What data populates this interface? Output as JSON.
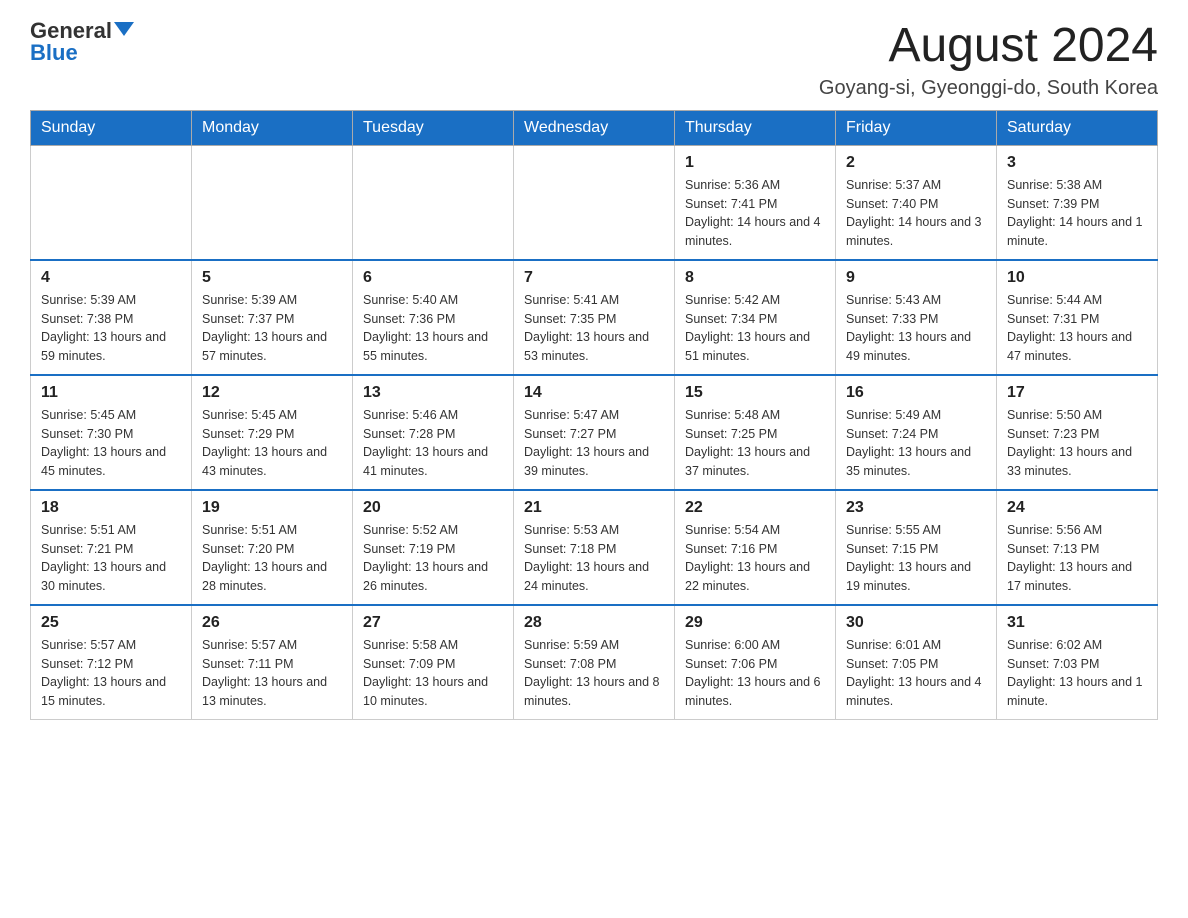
{
  "header": {
    "logo_general": "General",
    "logo_blue": "Blue",
    "month_title": "August 2024",
    "location": "Goyang-si, Gyeonggi-do, South Korea"
  },
  "days_of_week": [
    "Sunday",
    "Monday",
    "Tuesday",
    "Wednesday",
    "Thursday",
    "Friday",
    "Saturday"
  ],
  "weeks": [
    [
      {
        "day": "",
        "sunrise": "",
        "sunset": "",
        "daylight": ""
      },
      {
        "day": "",
        "sunrise": "",
        "sunset": "",
        "daylight": ""
      },
      {
        "day": "",
        "sunrise": "",
        "sunset": "",
        "daylight": ""
      },
      {
        "day": "",
        "sunrise": "",
        "sunset": "",
        "daylight": ""
      },
      {
        "day": "1",
        "sunrise": "Sunrise: 5:36 AM",
        "sunset": "Sunset: 7:41 PM",
        "daylight": "Daylight: 14 hours and 4 minutes."
      },
      {
        "day": "2",
        "sunrise": "Sunrise: 5:37 AM",
        "sunset": "Sunset: 7:40 PM",
        "daylight": "Daylight: 14 hours and 3 minutes."
      },
      {
        "day": "3",
        "sunrise": "Sunrise: 5:38 AM",
        "sunset": "Sunset: 7:39 PM",
        "daylight": "Daylight: 14 hours and 1 minute."
      }
    ],
    [
      {
        "day": "4",
        "sunrise": "Sunrise: 5:39 AM",
        "sunset": "Sunset: 7:38 PM",
        "daylight": "Daylight: 13 hours and 59 minutes."
      },
      {
        "day": "5",
        "sunrise": "Sunrise: 5:39 AM",
        "sunset": "Sunset: 7:37 PM",
        "daylight": "Daylight: 13 hours and 57 minutes."
      },
      {
        "day": "6",
        "sunrise": "Sunrise: 5:40 AM",
        "sunset": "Sunset: 7:36 PM",
        "daylight": "Daylight: 13 hours and 55 minutes."
      },
      {
        "day": "7",
        "sunrise": "Sunrise: 5:41 AM",
        "sunset": "Sunset: 7:35 PM",
        "daylight": "Daylight: 13 hours and 53 minutes."
      },
      {
        "day": "8",
        "sunrise": "Sunrise: 5:42 AM",
        "sunset": "Sunset: 7:34 PM",
        "daylight": "Daylight: 13 hours and 51 minutes."
      },
      {
        "day": "9",
        "sunrise": "Sunrise: 5:43 AM",
        "sunset": "Sunset: 7:33 PM",
        "daylight": "Daylight: 13 hours and 49 minutes."
      },
      {
        "day": "10",
        "sunrise": "Sunrise: 5:44 AM",
        "sunset": "Sunset: 7:31 PM",
        "daylight": "Daylight: 13 hours and 47 minutes."
      }
    ],
    [
      {
        "day": "11",
        "sunrise": "Sunrise: 5:45 AM",
        "sunset": "Sunset: 7:30 PM",
        "daylight": "Daylight: 13 hours and 45 minutes."
      },
      {
        "day": "12",
        "sunrise": "Sunrise: 5:45 AM",
        "sunset": "Sunset: 7:29 PM",
        "daylight": "Daylight: 13 hours and 43 minutes."
      },
      {
        "day": "13",
        "sunrise": "Sunrise: 5:46 AM",
        "sunset": "Sunset: 7:28 PM",
        "daylight": "Daylight: 13 hours and 41 minutes."
      },
      {
        "day": "14",
        "sunrise": "Sunrise: 5:47 AM",
        "sunset": "Sunset: 7:27 PM",
        "daylight": "Daylight: 13 hours and 39 minutes."
      },
      {
        "day": "15",
        "sunrise": "Sunrise: 5:48 AM",
        "sunset": "Sunset: 7:25 PM",
        "daylight": "Daylight: 13 hours and 37 minutes."
      },
      {
        "day": "16",
        "sunrise": "Sunrise: 5:49 AM",
        "sunset": "Sunset: 7:24 PM",
        "daylight": "Daylight: 13 hours and 35 minutes."
      },
      {
        "day": "17",
        "sunrise": "Sunrise: 5:50 AM",
        "sunset": "Sunset: 7:23 PM",
        "daylight": "Daylight: 13 hours and 33 minutes."
      }
    ],
    [
      {
        "day": "18",
        "sunrise": "Sunrise: 5:51 AM",
        "sunset": "Sunset: 7:21 PM",
        "daylight": "Daylight: 13 hours and 30 minutes."
      },
      {
        "day": "19",
        "sunrise": "Sunrise: 5:51 AM",
        "sunset": "Sunset: 7:20 PM",
        "daylight": "Daylight: 13 hours and 28 minutes."
      },
      {
        "day": "20",
        "sunrise": "Sunrise: 5:52 AM",
        "sunset": "Sunset: 7:19 PM",
        "daylight": "Daylight: 13 hours and 26 minutes."
      },
      {
        "day": "21",
        "sunrise": "Sunrise: 5:53 AM",
        "sunset": "Sunset: 7:18 PM",
        "daylight": "Daylight: 13 hours and 24 minutes."
      },
      {
        "day": "22",
        "sunrise": "Sunrise: 5:54 AM",
        "sunset": "Sunset: 7:16 PM",
        "daylight": "Daylight: 13 hours and 22 minutes."
      },
      {
        "day": "23",
        "sunrise": "Sunrise: 5:55 AM",
        "sunset": "Sunset: 7:15 PM",
        "daylight": "Daylight: 13 hours and 19 minutes."
      },
      {
        "day": "24",
        "sunrise": "Sunrise: 5:56 AM",
        "sunset": "Sunset: 7:13 PM",
        "daylight": "Daylight: 13 hours and 17 minutes."
      }
    ],
    [
      {
        "day": "25",
        "sunrise": "Sunrise: 5:57 AM",
        "sunset": "Sunset: 7:12 PM",
        "daylight": "Daylight: 13 hours and 15 minutes."
      },
      {
        "day": "26",
        "sunrise": "Sunrise: 5:57 AM",
        "sunset": "Sunset: 7:11 PM",
        "daylight": "Daylight: 13 hours and 13 minutes."
      },
      {
        "day": "27",
        "sunrise": "Sunrise: 5:58 AM",
        "sunset": "Sunset: 7:09 PM",
        "daylight": "Daylight: 13 hours and 10 minutes."
      },
      {
        "day": "28",
        "sunrise": "Sunrise: 5:59 AM",
        "sunset": "Sunset: 7:08 PM",
        "daylight": "Daylight: 13 hours and 8 minutes."
      },
      {
        "day": "29",
        "sunrise": "Sunrise: 6:00 AM",
        "sunset": "Sunset: 7:06 PM",
        "daylight": "Daylight: 13 hours and 6 minutes."
      },
      {
        "day": "30",
        "sunrise": "Sunrise: 6:01 AM",
        "sunset": "Sunset: 7:05 PM",
        "daylight": "Daylight: 13 hours and 4 minutes."
      },
      {
        "day": "31",
        "sunrise": "Sunrise: 6:02 AM",
        "sunset": "Sunset: 7:03 PM",
        "daylight": "Daylight: 13 hours and 1 minute."
      }
    ]
  ]
}
